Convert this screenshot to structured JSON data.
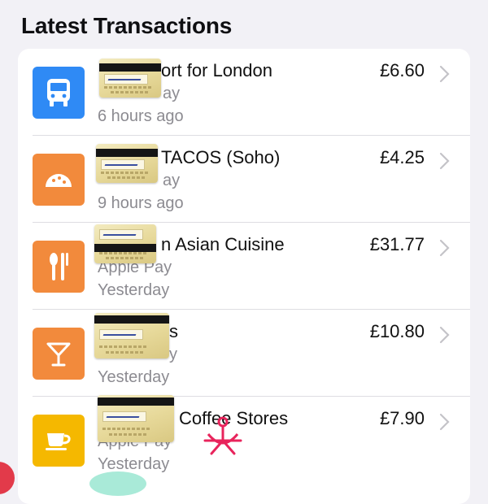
{
  "header": {
    "title": "Latest Transactions"
  },
  "transactions": [
    {
      "merchant": "ort for London",
      "method": "ay",
      "time": "6 hours ago",
      "amount": "£6.60",
      "icon": "bus-icon",
      "icon_color": "#2f8af5"
    },
    {
      "merchant": "TACOS (Soho)",
      "method": "ay",
      "time": "9 hours ago",
      "amount": "£4.25",
      "icon": "taco-icon",
      "icon_color": "#f28a3c"
    },
    {
      "merchant": "n Asian Cuisine",
      "method": "Apple Pay",
      "time": "Yesterday",
      "amount": "£31.77",
      "icon": "utensils-icon",
      "icon_color": "#f28a3c"
    },
    {
      "merchant": "s",
      "method": "y",
      "time": "Yesterday",
      "amount": "£10.80",
      "icon": "cocktail-icon",
      "icon_color": "#f28a3c"
    },
    {
      "merchant": "Coffee Stores",
      "method": "Apple Pay",
      "time": "Yesterday",
      "amount": "£7.90",
      "icon": "coffee-cup-icon",
      "icon_color": "#f5b800"
    }
  ],
  "colors": {
    "background": "#f2f1f6",
    "card": "#ffffff",
    "secondary_text": "#8c8b91",
    "watermark": "#e8245c"
  }
}
